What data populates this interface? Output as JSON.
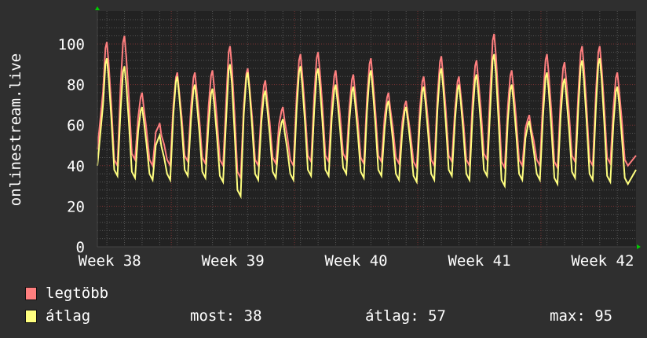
{
  "chart_data": {
    "type": "line",
    "ylabel": "onlinestream.live",
    "ylim": [
      0,
      115
    ],
    "xlim_days": [
      0,
      30.6
    ],
    "yticks": [
      0,
      20,
      40,
      60,
      80,
      100
    ],
    "xticks": [
      {
        "label": "Week 38",
        "day": 0.7
      },
      {
        "label": "Week 39",
        "day": 7.7
      },
      {
        "label": "Week 40",
        "day": 14.7
      },
      {
        "label": "Week 41",
        "day": 21.7
      },
      {
        "label": "Week 42",
        "day": 28.7
      }
    ],
    "grid": true,
    "first_peak_day": 0.54,
    "start_values": {
      "max": 48,
      "avg": 40
    },
    "end_values": {
      "max": 45,
      "avg": 38
    },
    "series": [
      {
        "name": "legtöbb",
        "color": "#ff7f7f",
        "daily_peaks": [
          101,
          104,
          76,
          61,
          86,
          86,
          87,
          99,
          88,
          82,
          69,
          95,
          96,
          87,
          85,
          93,
          76,
          72,
          84,
          94,
          84,
          92,
          105,
          87,
          65,
          95,
          91,
          99,
          99,
          86
        ],
        "daily_troughs": [
          40,
          43,
          40,
          40,
          42,
          41,
          40,
          34,
          40,
          41,
          40,
          42,
          42,
          43,
          41,
          42,
          41,
          39,
          40,
          42,
          40,
          43,
          39,
          40,
          40,
          39,
          42,
          40,
          41,
          40
        ]
      },
      {
        "name": "átlag",
        "color": "#ffff7f",
        "daily_peaks": [
          93,
          89,
          69,
          55,
          84,
          80,
          78,
          90,
          86,
          77,
          63,
          89,
          88,
          80,
          79,
          87,
          72,
          69,
          79,
          88,
          80,
          85,
          95,
          80,
          62,
          86,
          83,
          92,
          93,
          79
        ],
        "daily_troughs": [
          35,
          34,
          33,
          33,
          35,
          34,
          32,
          25,
          33,
          34,
          33,
          35,
          35,
          36,
          34,
          35,
          33,
          32,
          33,
          35,
          33,
          35,
          30,
          33,
          33,
          31,
          34,
          33,
          32,
          31
        ]
      }
    ],
    "legend": {
      "max_label": "legtöbb",
      "avg_label": "átlag",
      "now": "most: 38",
      "average": "átlag: 57",
      "maximum": "max: 95"
    }
  }
}
